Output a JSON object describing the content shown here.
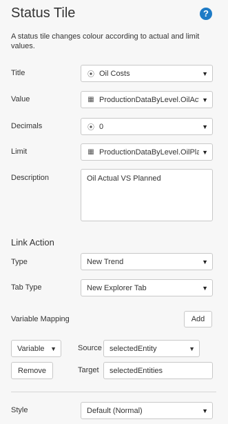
{
  "header": {
    "title": "Status Tile",
    "help_icon": "question-circle-icon"
  },
  "intro": "A status tile changes colour according to actual and limit values.",
  "form": {
    "title": {
      "label": "Title",
      "value": "Oil Costs",
      "icon": "radio-target-icon"
    },
    "value": {
      "label": "Value",
      "value": "ProductionDataByLevel.OilActual",
      "icon": "table-icon"
    },
    "decimals": {
      "label": "Decimals",
      "value": "0",
      "icon": "radio-target-icon"
    },
    "limit": {
      "label": "Limit",
      "value": "ProductionDataByLevel.OilPlanned",
      "icon": "table-icon"
    },
    "description": {
      "label": "Description",
      "value": "Oil Actual VS Planned"
    }
  },
  "link_action": {
    "heading": "Link Action",
    "type": {
      "label": "Type",
      "value": "New Trend"
    },
    "tab_type": {
      "label": "Tab Type",
      "value": "New Explorer Tab"
    },
    "variable_mapping": {
      "label": "Variable Mapping",
      "add_label": "Add"
    },
    "mapping": {
      "kind": "Variable",
      "source_label": "Source",
      "source_value": "selectedEntity",
      "target_label": "Target",
      "target_value": "selectedEntities",
      "remove_label": "Remove"
    }
  },
  "style": {
    "label": "Style",
    "value": "Default (Normal)"
  }
}
